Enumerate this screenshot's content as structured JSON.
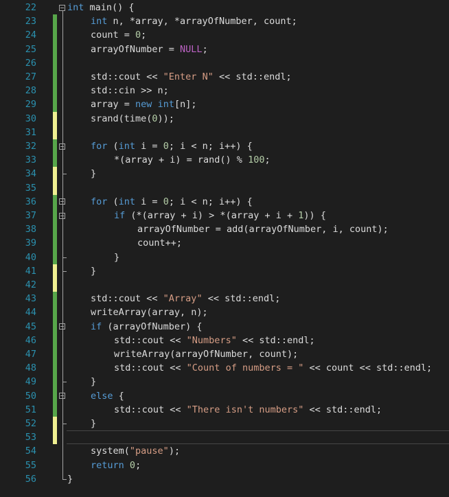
{
  "editor": {
    "language": "C++",
    "current_line": 53,
    "colors": {
      "background": "#1e1e1e",
      "line_number": "#2b91af",
      "keyword": "#569cd6",
      "string": "#d69d85",
      "number": "#b5cea8",
      "macro": "#bd63c5",
      "text": "#dcdcdc",
      "change_saved": "#57a64a",
      "change_unsaved": "#efef91"
    },
    "lines": [
      {
        "n": "22",
        "indent": 0,
        "fold": "open",
        "change": "none",
        "tokens": [
          {
            "t": "kw",
            "v": "int"
          },
          {
            "t": "p",
            "v": " main() {"
          }
        ]
      },
      {
        "n": "23",
        "indent": 1,
        "change": "saved",
        "tokens": [
          {
            "t": "kw",
            "v": "int"
          },
          {
            "t": "p",
            "v": " n, *array, *arrayOfNumber, count;"
          }
        ]
      },
      {
        "n": "24",
        "indent": 1,
        "change": "saved",
        "tokens": [
          {
            "t": "p",
            "v": "count = "
          },
          {
            "t": "num",
            "v": "0"
          },
          {
            "t": "p",
            "v": ";"
          }
        ]
      },
      {
        "n": "25",
        "indent": 1,
        "change": "saved",
        "tokens": [
          {
            "t": "p",
            "v": "arrayOfNumber = "
          },
          {
            "t": "mac",
            "v": "NULL"
          },
          {
            "t": "p",
            "v": ";"
          }
        ]
      },
      {
        "n": "26",
        "indent": 0,
        "change": "saved",
        "tokens": []
      },
      {
        "n": "27",
        "indent": 1,
        "change": "saved",
        "tokens": [
          {
            "t": "p",
            "v": "std::cout << "
          },
          {
            "t": "str",
            "v": "\"Enter N\""
          },
          {
            "t": "p",
            "v": " << std::endl;"
          }
        ]
      },
      {
        "n": "28",
        "indent": 1,
        "change": "saved",
        "tokens": [
          {
            "t": "p",
            "v": "std::cin >> n;"
          }
        ]
      },
      {
        "n": "29",
        "indent": 1,
        "change": "saved",
        "tokens": [
          {
            "t": "p",
            "v": "array = "
          },
          {
            "t": "kw",
            "v": "new"
          },
          {
            "t": "p",
            "v": " "
          },
          {
            "t": "kw",
            "v": "int"
          },
          {
            "t": "p",
            "v": "[n];"
          }
        ]
      },
      {
        "n": "30",
        "indent": 1,
        "change": "unsaved",
        "tokens": [
          {
            "t": "p",
            "v": "srand(time("
          },
          {
            "t": "num",
            "v": "0"
          },
          {
            "t": "p",
            "v": "));"
          }
        ]
      },
      {
        "n": "31",
        "indent": 0,
        "change": "unsaved",
        "tokens": []
      },
      {
        "n": "32",
        "indent": 1,
        "fold": "open",
        "change": "saved",
        "tokens": [
          {
            "t": "kw",
            "v": "for"
          },
          {
            "t": "p",
            "v": " ("
          },
          {
            "t": "kw",
            "v": "int"
          },
          {
            "t": "p",
            "v": " i = "
          },
          {
            "t": "num",
            "v": "0"
          },
          {
            "t": "p",
            "v": "; i < n; i++) {"
          }
        ]
      },
      {
        "n": "33",
        "indent": 2,
        "change": "saved",
        "tokens": [
          {
            "t": "p",
            "v": "*(array + i) = rand() % "
          },
          {
            "t": "num",
            "v": "100"
          },
          {
            "t": "p",
            "v": ";"
          }
        ]
      },
      {
        "n": "34",
        "indent": 1,
        "change": "unsaved",
        "tokens": [
          {
            "t": "p",
            "v": "}"
          }
        ]
      },
      {
        "n": "35",
        "indent": 0,
        "change": "unsaved",
        "tokens": []
      },
      {
        "n": "36",
        "indent": 1,
        "fold": "open",
        "change": "saved",
        "tokens": [
          {
            "t": "kw",
            "v": "for"
          },
          {
            "t": "p",
            "v": " ("
          },
          {
            "t": "kw",
            "v": "int"
          },
          {
            "t": "p",
            "v": " i = "
          },
          {
            "t": "num",
            "v": "0"
          },
          {
            "t": "p",
            "v": "; i < n; i++) {"
          }
        ]
      },
      {
        "n": "37",
        "indent": 2,
        "fold": "open",
        "change": "saved",
        "tokens": [
          {
            "t": "kw",
            "v": "if"
          },
          {
            "t": "p",
            "v": " (*(array + i) > *(array + i + "
          },
          {
            "t": "num",
            "v": "1"
          },
          {
            "t": "p",
            "v": ")) {"
          }
        ]
      },
      {
        "n": "38",
        "indent": 3,
        "change": "saved",
        "tokens": [
          {
            "t": "p",
            "v": "arrayOfNumber = add(arrayOfNumber, i, count);"
          }
        ]
      },
      {
        "n": "39",
        "indent": 3,
        "change": "saved",
        "tokens": [
          {
            "t": "p",
            "v": "count++;"
          }
        ]
      },
      {
        "n": "40",
        "indent": 2,
        "change": "saved",
        "tokens": [
          {
            "t": "p",
            "v": "}"
          }
        ]
      },
      {
        "n": "41",
        "indent": 1,
        "change": "unsaved",
        "tokens": [
          {
            "t": "p",
            "v": "}"
          }
        ]
      },
      {
        "n": "42",
        "indent": 0,
        "change": "unsaved",
        "tokens": []
      },
      {
        "n": "43",
        "indent": 1,
        "change": "saved",
        "tokens": [
          {
            "t": "p",
            "v": "std::cout << "
          },
          {
            "t": "str",
            "v": "\"Array\""
          },
          {
            "t": "p",
            "v": " << std::endl;"
          }
        ]
      },
      {
        "n": "44",
        "indent": 1,
        "change": "saved",
        "tokens": [
          {
            "t": "p",
            "v": "writeArray(array, n);"
          }
        ]
      },
      {
        "n": "45",
        "indent": 1,
        "fold": "open",
        "change": "saved",
        "tokens": [
          {
            "t": "kw",
            "v": "if"
          },
          {
            "t": "p",
            "v": " (arrayOfNumber) {"
          }
        ]
      },
      {
        "n": "46",
        "indent": 2,
        "change": "saved",
        "tokens": [
          {
            "t": "p",
            "v": "std::cout << "
          },
          {
            "t": "str",
            "v": "\"Numbers\""
          },
          {
            "t": "p",
            "v": " << std::endl;"
          }
        ]
      },
      {
        "n": "47",
        "indent": 2,
        "change": "saved",
        "tokens": [
          {
            "t": "p",
            "v": "writeArray(arrayOfNumber, count);"
          }
        ]
      },
      {
        "n": "48",
        "indent": 2,
        "change": "saved",
        "tokens": [
          {
            "t": "p",
            "v": "std::cout << "
          },
          {
            "t": "str",
            "v": "\"Count of numbers = \""
          },
          {
            "t": "p",
            "v": " << count << std::endl;"
          }
        ]
      },
      {
        "n": "49",
        "indent": 1,
        "change": "saved",
        "tokens": [
          {
            "t": "p",
            "v": "}"
          }
        ]
      },
      {
        "n": "50",
        "indent": 1,
        "fold": "open",
        "change": "saved",
        "tokens": [
          {
            "t": "kw",
            "v": "else"
          },
          {
            "t": "p",
            "v": " {"
          }
        ]
      },
      {
        "n": "51",
        "indent": 2,
        "change": "saved",
        "tokens": [
          {
            "t": "p",
            "v": "std::cout << "
          },
          {
            "t": "str",
            "v": "\"There isn't numbers\""
          },
          {
            "t": "p",
            "v": " << std::endl;"
          }
        ]
      },
      {
        "n": "52",
        "indent": 1,
        "change": "unsaved",
        "tokens": [
          {
            "t": "p",
            "v": "}"
          }
        ]
      },
      {
        "n": "53",
        "indent": 0,
        "change": "unsaved",
        "tokens": []
      },
      {
        "n": "54",
        "indent": 1,
        "change": "none",
        "tokens": [
          {
            "t": "p",
            "v": "system("
          },
          {
            "t": "str",
            "v": "\"pause\""
          },
          {
            "t": "p",
            "v": ");"
          }
        ]
      },
      {
        "n": "55",
        "indent": 1,
        "change": "none",
        "tokens": [
          {
            "t": "kw",
            "v": "return"
          },
          {
            "t": "p",
            "v": " "
          },
          {
            "t": "num",
            "v": "0"
          },
          {
            "t": "p",
            "v": ";"
          }
        ]
      },
      {
        "n": "56",
        "indent": 0,
        "change": "none",
        "tokens": [
          {
            "t": "p",
            "v": "}"
          }
        ]
      }
    ]
  }
}
